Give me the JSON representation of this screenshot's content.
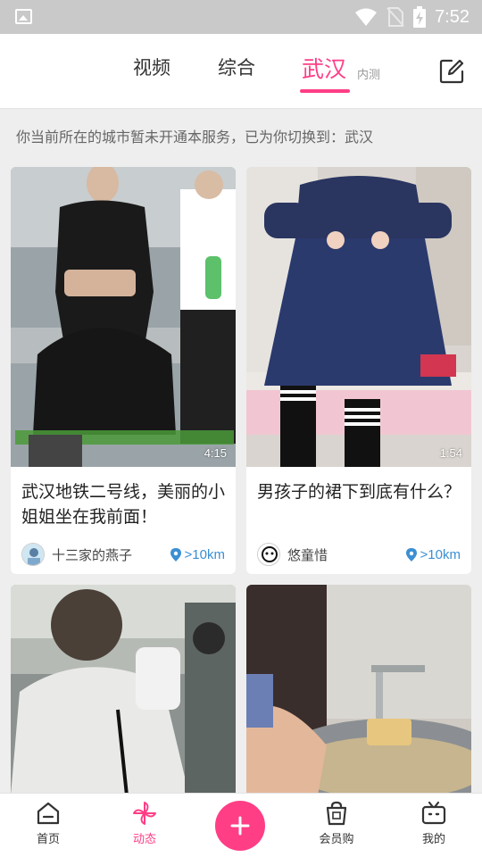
{
  "status_bar": {
    "time": "7:52",
    "icons": [
      "image-icon",
      "wifi-icon",
      "no-sim-icon",
      "battery-charging-icon"
    ]
  },
  "tabs": {
    "video": "视频",
    "general": "综合",
    "city": "武汉",
    "city_badge": "内测",
    "active_tab": "武汉"
  },
  "notice": "你当前所在的城市暂未开通本服务，已为你切换到：武汉",
  "feed": [
    {
      "duration": "4:15",
      "title": "武汉地铁二号线，美丽的小姐姐坐在我前面！",
      "author": "十三家的燕子",
      "distance": ">10km"
    },
    {
      "duration": "1:54",
      "title": "男孩子的裙下到底有什么？",
      "author": "悠童惜",
      "distance": ">10km"
    },
    {
      "duration": "",
      "title": "",
      "author": "",
      "distance": ""
    },
    {
      "duration": "",
      "title": "",
      "author": "",
      "distance": ""
    }
  ],
  "bottom_nav": {
    "home": "首页",
    "feed": "动态",
    "vip": "会员购",
    "mine": "我的",
    "active": "动态"
  },
  "colors": {
    "accent": "#ff3e86",
    "distance": "#3b8fd3",
    "status_bar": "#c9c9c9"
  }
}
